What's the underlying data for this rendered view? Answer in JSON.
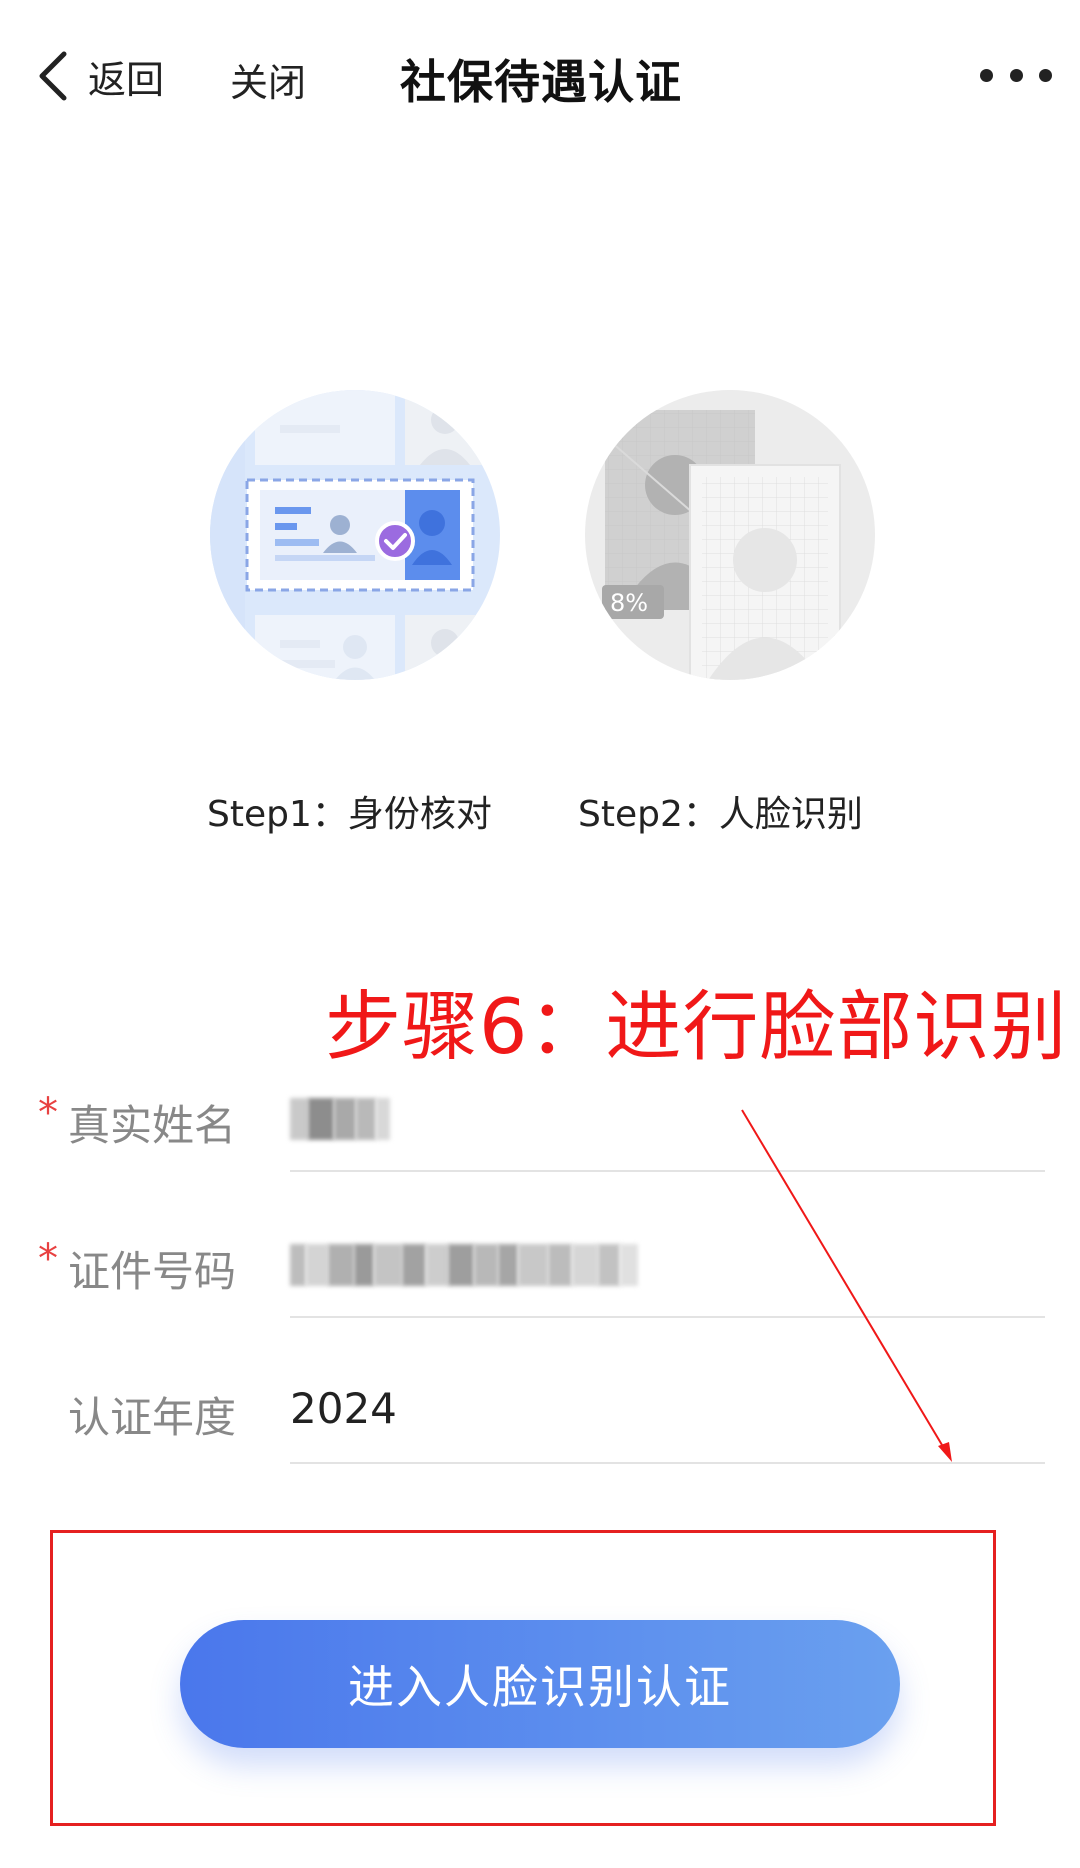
{
  "nav": {
    "back_label": "返回",
    "close_label": "关闭",
    "title": "社保待遇认证",
    "more_icon": "more-dots-icon"
  },
  "steps": [
    {
      "label": "Step1：身份核对",
      "illustration": "id-card-verification-illustration",
      "active": true
    },
    {
      "label": "Step2：人脸识别",
      "illustration": "face-recognition-illustration",
      "active": false,
      "progress_text": "8%"
    }
  ],
  "annotation": {
    "text": "步骤6：进行脸部识别",
    "color": "#f01818"
  },
  "form": {
    "name": {
      "label": "真实姓名",
      "required": true,
      "value_masked": true
    },
    "id_number": {
      "label": "证件号码",
      "required": true,
      "value_masked": true
    },
    "year": {
      "label": "认证年度",
      "required": false,
      "value": "2024"
    }
  },
  "cta": {
    "label": "进入人脸识别认证",
    "gradient_start": "#4a77ec",
    "gradient_end": "#6aa0ef"
  },
  "colors": {
    "required_star": "#e84141",
    "annotation": "#f01818",
    "highlight_border": "#e52020"
  }
}
